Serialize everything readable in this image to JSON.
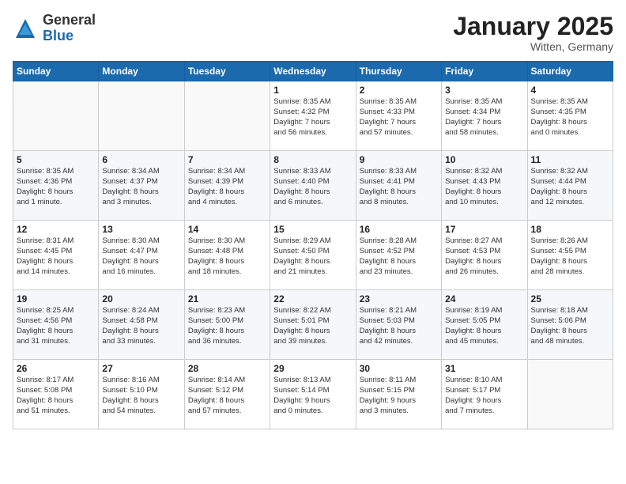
{
  "header": {
    "logo_general": "General",
    "logo_blue": "Blue",
    "title": "January 2025",
    "subtitle": "Witten, Germany"
  },
  "weekdays": [
    "Sunday",
    "Monday",
    "Tuesday",
    "Wednesday",
    "Thursday",
    "Friday",
    "Saturday"
  ],
  "weeks": [
    [
      {
        "day": "",
        "info": ""
      },
      {
        "day": "",
        "info": ""
      },
      {
        "day": "",
        "info": ""
      },
      {
        "day": "1",
        "info": "Sunrise: 8:35 AM\nSunset: 4:32 PM\nDaylight: 7 hours\nand 56 minutes."
      },
      {
        "day": "2",
        "info": "Sunrise: 8:35 AM\nSunset: 4:33 PM\nDaylight: 7 hours\nand 57 minutes."
      },
      {
        "day": "3",
        "info": "Sunrise: 8:35 AM\nSunset: 4:34 PM\nDaylight: 7 hours\nand 58 minutes."
      },
      {
        "day": "4",
        "info": "Sunrise: 8:35 AM\nSunset: 4:35 PM\nDaylight: 8 hours\nand 0 minutes."
      }
    ],
    [
      {
        "day": "5",
        "info": "Sunrise: 8:35 AM\nSunset: 4:36 PM\nDaylight: 8 hours\nand 1 minute."
      },
      {
        "day": "6",
        "info": "Sunrise: 8:34 AM\nSunset: 4:37 PM\nDaylight: 8 hours\nand 3 minutes."
      },
      {
        "day": "7",
        "info": "Sunrise: 8:34 AM\nSunset: 4:39 PM\nDaylight: 8 hours\nand 4 minutes."
      },
      {
        "day": "8",
        "info": "Sunrise: 8:33 AM\nSunset: 4:40 PM\nDaylight: 8 hours\nand 6 minutes."
      },
      {
        "day": "9",
        "info": "Sunrise: 8:33 AM\nSunset: 4:41 PM\nDaylight: 8 hours\nand 8 minutes."
      },
      {
        "day": "10",
        "info": "Sunrise: 8:32 AM\nSunset: 4:43 PM\nDaylight: 8 hours\nand 10 minutes."
      },
      {
        "day": "11",
        "info": "Sunrise: 8:32 AM\nSunset: 4:44 PM\nDaylight: 8 hours\nand 12 minutes."
      }
    ],
    [
      {
        "day": "12",
        "info": "Sunrise: 8:31 AM\nSunset: 4:45 PM\nDaylight: 8 hours\nand 14 minutes."
      },
      {
        "day": "13",
        "info": "Sunrise: 8:30 AM\nSunset: 4:47 PM\nDaylight: 8 hours\nand 16 minutes."
      },
      {
        "day": "14",
        "info": "Sunrise: 8:30 AM\nSunset: 4:48 PM\nDaylight: 8 hours\nand 18 minutes."
      },
      {
        "day": "15",
        "info": "Sunrise: 8:29 AM\nSunset: 4:50 PM\nDaylight: 8 hours\nand 21 minutes."
      },
      {
        "day": "16",
        "info": "Sunrise: 8:28 AM\nSunset: 4:52 PM\nDaylight: 8 hours\nand 23 minutes."
      },
      {
        "day": "17",
        "info": "Sunrise: 8:27 AM\nSunset: 4:53 PM\nDaylight: 8 hours\nand 26 minutes."
      },
      {
        "day": "18",
        "info": "Sunrise: 8:26 AM\nSunset: 4:55 PM\nDaylight: 8 hours\nand 28 minutes."
      }
    ],
    [
      {
        "day": "19",
        "info": "Sunrise: 8:25 AM\nSunset: 4:56 PM\nDaylight: 8 hours\nand 31 minutes."
      },
      {
        "day": "20",
        "info": "Sunrise: 8:24 AM\nSunset: 4:58 PM\nDaylight: 8 hours\nand 33 minutes."
      },
      {
        "day": "21",
        "info": "Sunrise: 8:23 AM\nSunset: 5:00 PM\nDaylight: 8 hours\nand 36 minutes."
      },
      {
        "day": "22",
        "info": "Sunrise: 8:22 AM\nSunset: 5:01 PM\nDaylight: 8 hours\nand 39 minutes."
      },
      {
        "day": "23",
        "info": "Sunrise: 8:21 AM\nSunset: 5:03 PM\nDaylight: 8 hours\nand 42 minutes."
      },
      {
        "day": "24",
        "info": "Sunrise: 8:19 AM\nSunset: 5:05 PM\nDaylight: 8 hours\nand 45 minutes."
      },
      {
        "day": "25",
        "info": "Sunrise: 8:18 AM\nSunset: 5:06 PM\nDaylight: 8 hours\nand 48 minutes."
      }
    ],
    [
      {
        "day": "26",
        "info": "Sunrise: 8:17 AM\nSunset: 5:08 PM\nDaylight: 8 hours\nand 51 minutes."
      },
      {
        "day": "27",
        "info": "Sunrise: 8:16 AM\nSunset: 5:10 PM\nDaylight: 8 hours\nand 54 minutes."
      },
      {
        "day": "28",
        "info": "Sunrise: 8:14 AM\nSunset: 5:12 PM\nDaylight: 8 hours\nand 57 minutes."
      },
      {
        "day": "29",
        "info": "Sunrise: 8:13 AM\nSunset: 5:14 PM\nDaylight: 9 hours\nand 0 minutes."
      },
      {
        "day": "30",
        "info": "Sunrise: 8:11 AM\nSunset: 5:15 PM\nDaylight: 9 hours\nand 3 minutes."
      },
      {
        "day": "31",
        "info": "Sunrise: 8:10 AM\nSunset: 5:17 PM\nDaylight: 9 hours\nand 7 minutes."
      },
      {
        "day": "",
        "info": ""
      }
    ]
  ]
}
